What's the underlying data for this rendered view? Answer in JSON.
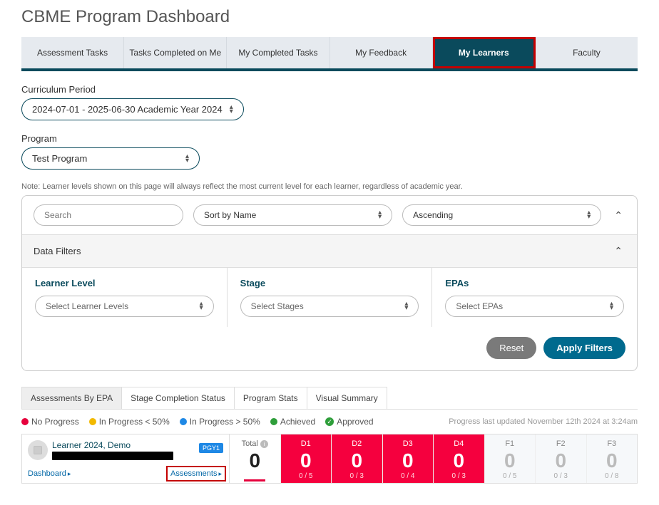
{
  "page": {
    "title": "CBME Program Dashboard"
  },
  "tabs": [
    {
      "label": "Assessment Tasks"
    },
    {
      "label": "Tasks Completed on Me"
    },
    {
      "label": "My Completed Tasks"
    },
    {
      "label": "My Feedback"
    },
    {
      "label": "My Learners",
      "active": true
    },
    {
      "label": "Faculty"
    }
  ],
  "filters": {
    "curriculum_label": "Curriculum Period",
    "curriculum_value": "2024-07-01 - 2025-06-30 Academic Year 2024",
    "program_label": "Program",
    "program_value": "Test Program",
    "note": "Note: Learner levels shown on this page will always reflect the most current level for each learner, regardless of academic year.",
    "search_placeholder": "Search",
    "sort_value": "Sort by Name",
    "direction_value": "Ascending",
    "df_header": "Data Filters",
    "learner_level": {
      "label": "Learner Level",
      "placeholder": "Select Learner Levels"
    },
    "stage": {
      "label": "Stage",
      "placeholder": "Select Stages"
    },
    "epas": {
      "label": "EPAs",
      "placeholder": "Select EPAs"
    },
    "reset": "Reset",
    "apply": "Apply Filters"
  },
  "subtabs": [
    {
      "label": "Assessments By EPA",
      "active": true
    },
    {
      "label": "Stage Completion Status"
    },
    {
      "label": "Program Stats"
    },
    {
      "label": "Visual Summary"
    }
  ],
  "legend": {
    "items": [
      {
        "label": "No Progress"
      },
      {
        "label": "In Progress < 50%"
      },
      {
        "label": "In Progress > 50%"
      },
      {
        "label": "Achieved"
      },
      {
        "label": "Approved"
      }
    ],
    "updated": "Progress last updated November 12th 2024 at 3:24am"
  },
  "learner": {
    "name": "Learner 2024, Demo",
    "badge": "PGY1",
    "dashboard_link": "Dashboard",
    "assessments_link": "Assessments",
    "stats": {
      "total": {
        "head": "Total",
        "big": "0"
      },
      "d1": {
        "head": "D1",
        "big": "0",
        "sub": "0 / 5"
      },
      "d2": {
        "head": "D2",
        "big": "0",
        "sub": "0 / 3"
      },
      "d3": {
        "head": "D3",
        "big": "0",
        "sub": "0 / 4"
      },
      "d4": {
        "head": "D4",
        "big": "0",
        "sub": "0 / 3"
      },
      "f1": {
        "head": "F1",
        "big": "0",
        "sub": "0 / 5"
      },
      "f2": {
        "head": "F2",
        "big": "0",
        "sub": "0 / 3"
      },
      "f3": {
        "head": "F3",
        "big": "0",
        "sub": "0 / 8"
      }
    }
  }
}
